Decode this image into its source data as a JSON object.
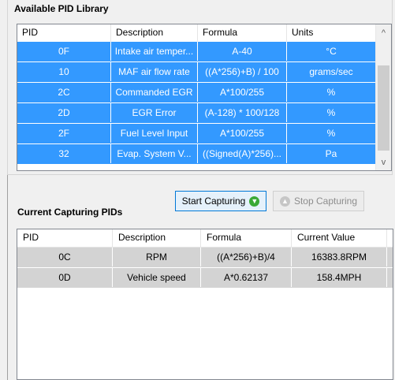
{
  "library": {
    "title": "Available PID Library",
    "columns": [
      "PID",
      "Description",
      "Formula",
      "Units"
    ],
    "rows": [
      {
        "pid": "0F",
        "description": "Intake air temper...",
        "formula": "A-40",
        "units": "°C"
      },
      {
        "pid": "10",
        "description": "MAF air flow rate",
        "formula": "((A*256)+B) / 100",
        "units": "grams/sec"
      },
      {
        "pid": "2C",
        "description": "Commanded EGR",
        "formula": "A*100/255",
        "units": "%"
      },
      {
        "pid": "2D",
        "description": "EGR Error",
        "formula": "(A-128) * 100/128",
        "units": "%"
      },
      {
        "pid": "2F",
        "description": "Fuel Level Input",
        "formula": "A*100/255",
        "units": "%"
      },
      {
        "pid": "32",
        "description": "Evap. System V...",
        "formula": "((Signed(A)*256)...",
        "units": "Pa"
      }
    ],
    "scroll_up": "^",
    "scroll_down": "v"
  },
  "buttons": {
    "start_label": "Start Capturing",
    "stop_label": "Stop Capturing"
  },
  "capturing": {
    "title": "Current Capturing PIDs",
    "columns": [
      "PID",
      "Description",
      "Formula",
      "Current Value"
    ],
    "rows": [
      {
        "pid": "0C",
        "description": "RPM",
        "formula": "((A*256)+B)/4",
        "value": "16383.8RPM"
      },
      {
        "pid": "0D",
        "description": "Vehicle speed",
        "formula": "A*0.62137",
        "value": "158.4MPH"
      }
    ]
  },
  "colors": {
    "selection": "#3399ff",
    "captured_row": "#d3d3d3",
    "start_icon": "#3aa935"
  },
  "icons": {
    "start": "arrow-down-circle-icon",
    "stop": "arrow-up-circle-icon"
  }
}
